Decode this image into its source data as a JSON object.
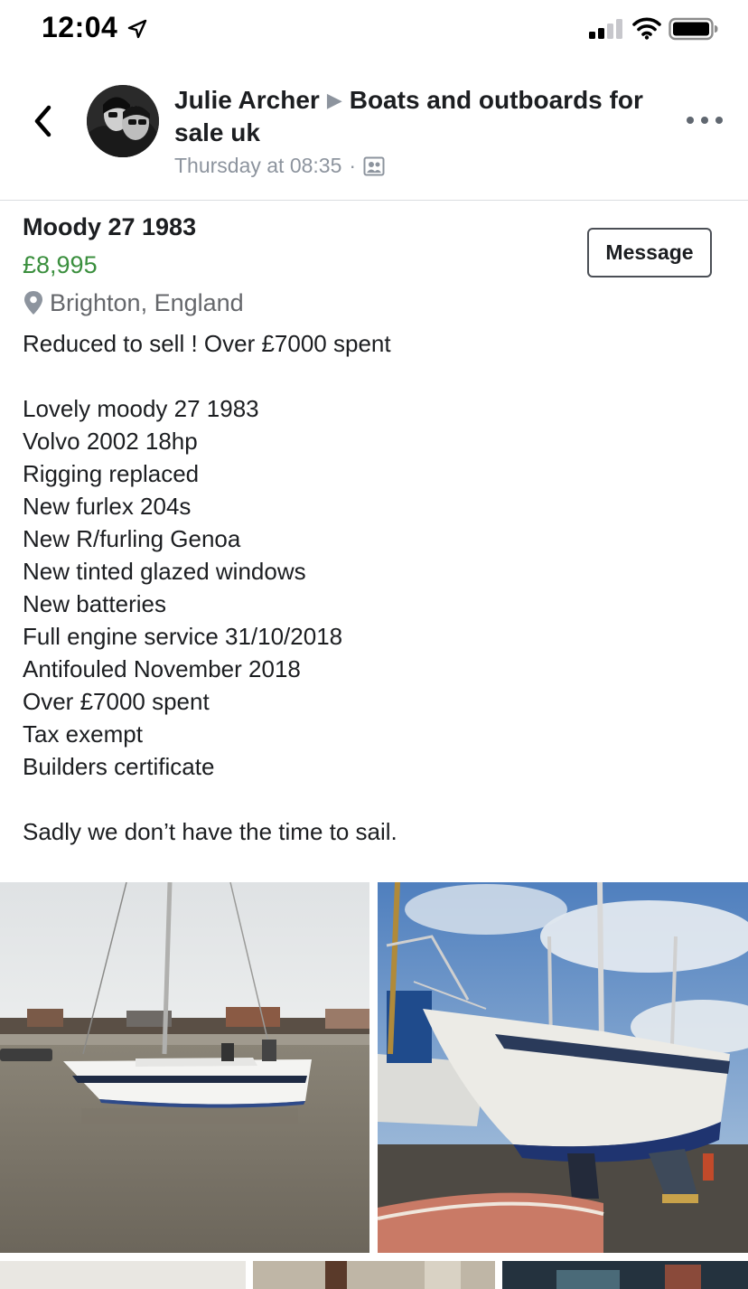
{
  "status_bar": {
    "time": "12:04"
  },
  "header": {
    "author": "Julie Archer",
    "group": "Boats and outboards for sale uk",
    "timestamp": "Thursday at 08:35",
    "separator": "·"
  },
  "listing": {
    "title": "Moody 27 1983",
    "price": "£8,995",
    "location": "Brighton, England",
    "message_label": "Message",
    "description": [
      "Reduced to sell ! Over £7000 spent",
      "",
      "Lovely moody 27 1983",
      "Volvo 2002 18hp",
      "Rigging replaced",
      "New furlex 204s",
      "New R/furling Genoa",
      "New tinted glazed windows",
      "New batteries",
      "Full engine service 31/10/2018",
      "Antifouled November 2018",
      "Over £7000 spent",
      "Tax exempt",
      "Builders certificate",
      "",
      "Sadly we don’t have the time to sail."
    ]
  },
  "colors": {
    "price": "#3b8f3e",
    "secondary_text": "#8d949e",
    "primary_text": "#1c1e21"
  },
  "icons": {
    "back": "chevron-left-icon",
    "more": "more-horizontal-icon",
    "audience": "group-audience-icon",
    "location": "map-pin-icon"
  }
}
